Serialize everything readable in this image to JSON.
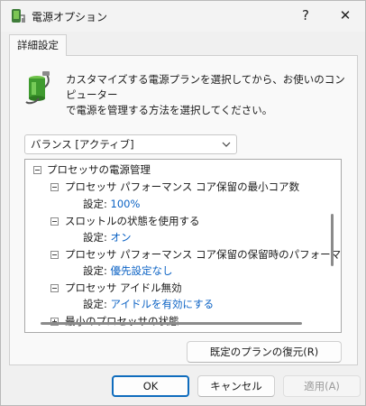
{
  "window": {
    "title": "電源オプション",
    "help_glyph": "?",
    "close_glyph": "✕"
  },
  "tab": {
    "label": "詳細設定"
  },
  "description": {
    "line1": "カスタマイズする電源プランを選択してから、お使いのコンピューター",
    "line2": "で電源を管理する方法を選択してください。"
  },
  "plan_select": {
    "value": "バランス [アクティブ]"
  },
  "tree": {
    "root": "プロセッサの電源管理",
    "items": [
      {
        "label": "プロセッサ パフォーマンス コア保留の最小コア数",
        "setting_label": "設定:",
        "value": "100%"
      },
      {
        "label": "スロットルの状態を使用する",
        "setting_label": "設定:",
        "value": "オン"
      },
      {
        "label": "プロセッサ パフォーマンス コア保留の保留時のパフォーマンス状態",
        "setting_label": "設定:",
        "value": "優先設定なし"
      },
      {
        "label": "プロセッサ アイドル無効",
        "setting_label": "設定:",
        "value": "アイドルを有効にする"
      },
      {
        "label": "最小のプロセッサの状態"
      }
    ]
  },
  "buttons": {
    "restore": "既定のプランの復元(R)",
    "ok": "OK",
    "cancel": "キャンセル",
    "apply": "適用(A)"
  },
  "colors": {
    "accent": "#0f6cbd",
    "link_value": "#0b62c4"
  },
  "icons": {
    "app": "power-options-icon",
    "info": "battery-plug-icon",
    "dropdown": "chevron-down-icon"
  }
}
